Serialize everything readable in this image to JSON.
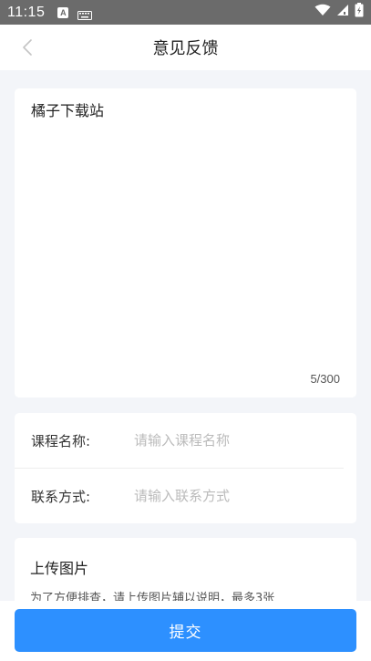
{
  "status_bar": {
    "time": "11:15",
    "icons": [
      "text-a-icon",
      "keyboard-icon",
      "wifi-icon",
      "signal-icon",
      "battery-icon"
    ]
  },
  "nav": {
    "title": "意见反馈",
    "back_icon": "chevron-left-icon"
  },
  "feedback": {
    "value": "橘子下载站",
    "char_count": "5/300"
  },
  "form": {
    "course_label": "课程名称:",
    "course_placeholder": "请输入课程名称",
    "contact_label": "联系方式:",
    "contact_placeholder": "请输入联系方式"
  },
  "upload": {
    "title": "上传图片",
    "hint": "为了方便排查，请上传图片辅以说明，最多3张"
  },
  "submit_label": "提交",
  "colors": {
    "accent": "#2d90ff",
    "page_background": "#f3f5f9",
    "status_bar": "#6b6b6b"
  }
}
